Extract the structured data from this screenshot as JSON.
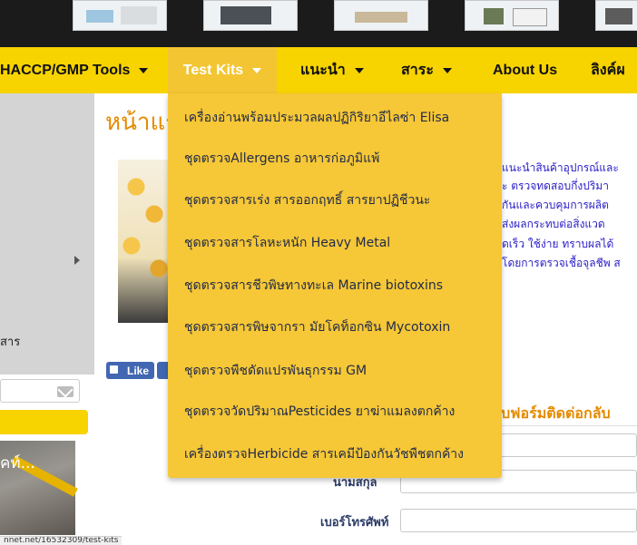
{
  "nav": {
    "items": [
      {
        "label": "HACCP/GMP Tools"
      },
      {
        "label": "Test Kits"
      },
      {
        "label": "แนะนำ"
      },
      {
        "label": "สาระ"
      },
      {
        "label": "About Us"
      },
      {
        "label": "ลิงค์ผ"
      }
    ]
  },
  "dropdown": {
    "items": [
      {
        "label": "เครื่องอ่านพร้อมประมวลผลปฏิกิริยาอีไลซ่า Elisa"
      },
      {
        "label": "ชุดตรวจAllergens อาหารก่อภูมิแพ้"
      },
      {
        "label": "ชุดตรวจสารเร่ง สารออกฤทธิ์ สารยาปฏิชีวนะ"
      },
      {
        "label": "ชุดตรวจสารโลหะหนัก Heavy Metal"
      },
      {
        "label": "ชุดตรวจสารชีวพิษทางทะเล Marine biotoxins"
      },
      {
        "label": "ชุดตรวจสารพิษจากรา มัยโคท็อกซิน Mycotoxin"
      },
      {
        "label": "ชุดตรวจพืชดัดแปรพันธุกรรม GM"
      },
      {
        "label": "ชุดตรวจวัดปริมาณPesticides ยาฆ่าแมลงตกค้าง"
      },
      {
        "label": "เครื่องตรวจHerbicide สารเคมีป้องกันวัชพืชตกค้าง"
      }
    ]
  },
  "page": {
    "title": "หน้าแร",
    "body_lines": [
      "แนะนำสินค้าอุปกรณ์และ",
      "ะ ตรวจทดสอบกึ่งปริมา",
      "กันและควบคุมการผลิต",
      "ส่งผลกระทบต่อสิ่งแวด",
      "ดเร็ว ใช้ง่าย ทราบผลได้",
      "โดยการตรวจเชื้อจุลชีพ ส"
    ]
  },
  "social": {
    "like_label": "Like"
  },
  "sidebar": {
    "text": "สาร",
    "image_caption": "คท์..."
  },
  "form": {
    "title": "บฟอร์มติดต่อกลับ",
    "name_label": "นามสกุล",
    "phone_label": "เบอร์โทรศัพท์"
  },
  "status_bar": {
    "url": "nnet.net/16532309/test-kits"
  },
  "colors": {
    "nav_bg": "#f7d300",
    "dropdown_bg": "#f6c736",
    "title_orange": "#e58a00",
    "body_blue": "#2b20c8"
  },
  "icons": {
    "nav_caret": "chevron-down-icon",
    "sidebar_arrow": "chevron-right-icon",
    "mail": "mail-icon",
    "like": "thumbs-up-icon"
  }
}
